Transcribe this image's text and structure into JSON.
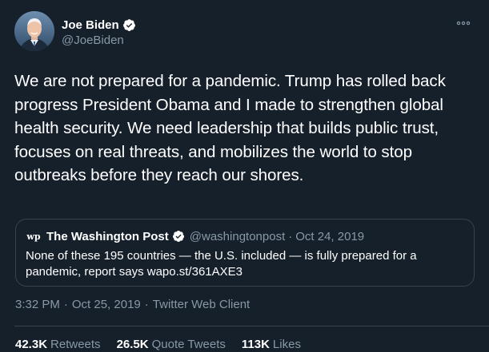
{
  "tweet": {
    "author": {
      "display_name": "Joe Biden",
      "handle": "@JoeBiden",
      "verified": true
    },
    "text": "We are not prepared for a pandemic. Trump has rolled back progress President Obama and I made to strengthen global health security. We need leadership that builds public trust, focuses on real threats, and mobilizes the world to stop outbreaks before they reach our shores.",
    "quoted": {
      "display_name": "The Washington Post",
      "logo": "wp",
      "handle": "@washingtonpost",
      "separator": "·",
      "date": "Oct 24, 2019",
      "text": "None of these 195 countries — the U.S. included — is fully prepared for a pandemic, report says wapo.st/361AXE3"
    },
    "meta": {
      "time": "3:32 PM",
      "date": "Oct 25, 2019",
      "separator": "·",
      "client": "Twitter Web Client"
    },
    "stats": {
      "retweets_count": "42.3K",
      "retweets_label": "Retweets",
      "quotes_count": "26.5K",
      "quotes_label": "Quote Tweets",
      "likes_count": "113K",
      "likes_label": "Likes"
    }
  },
  "colors": {
    "background": "#15202b",
    "secondary_text": "#8899a6",
    "border": "#38444d",
    "verified": "#ffffff"
  },
  "icons": {
    "verified": "verified-badge-icon",
    "more": "more-options-icon"
  }
}
